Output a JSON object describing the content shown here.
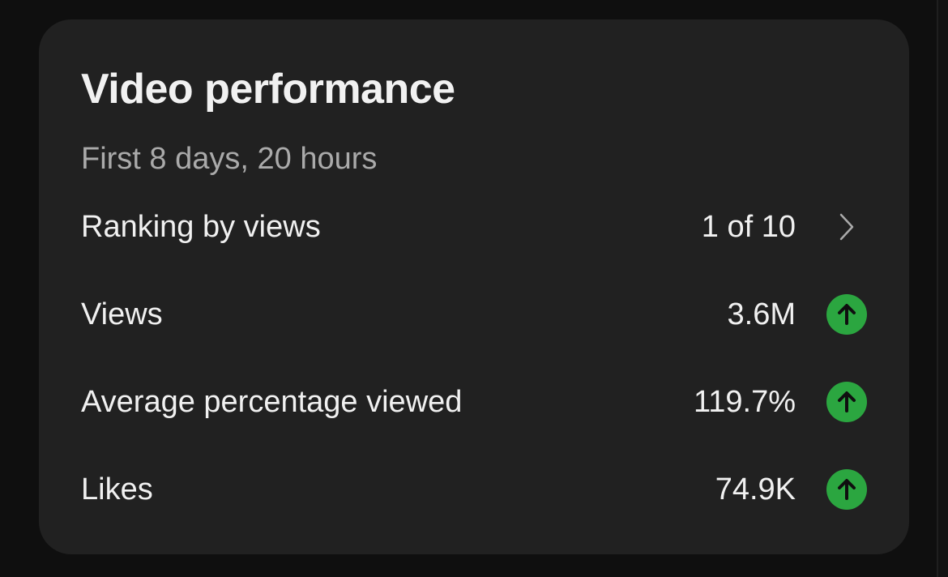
{
  "card": {
    "title": "Video performance",
    "subtitle": "First 8 days, 20 hours",
    "rows": [
      {
        "label": "Ranking by views",
        "value": "1 of 10",
        "indicator": "chevron-right-icon"
      },
      {
        "label": "Views",
        "value": "3.6M",
        "indicator": "arrow-up-icon"
      },
      {
        "label": "Average percentage viewed",
        "value": "119.7%",
        "indicator": "arrow-up-icon"
      },
      {
        "label": "Likes",
        "value": "74.9K",
        "indicator": "arrow-up-icon"
      }
    ]
  },
  "colors": {
    "background": "#0f0f0f",
    "card": "#212121",
    "text_primary": "#f1f1f1",
    "text_secondary": "#aaaaaa",
    "trend_up": "#2ba640"
  }
}
